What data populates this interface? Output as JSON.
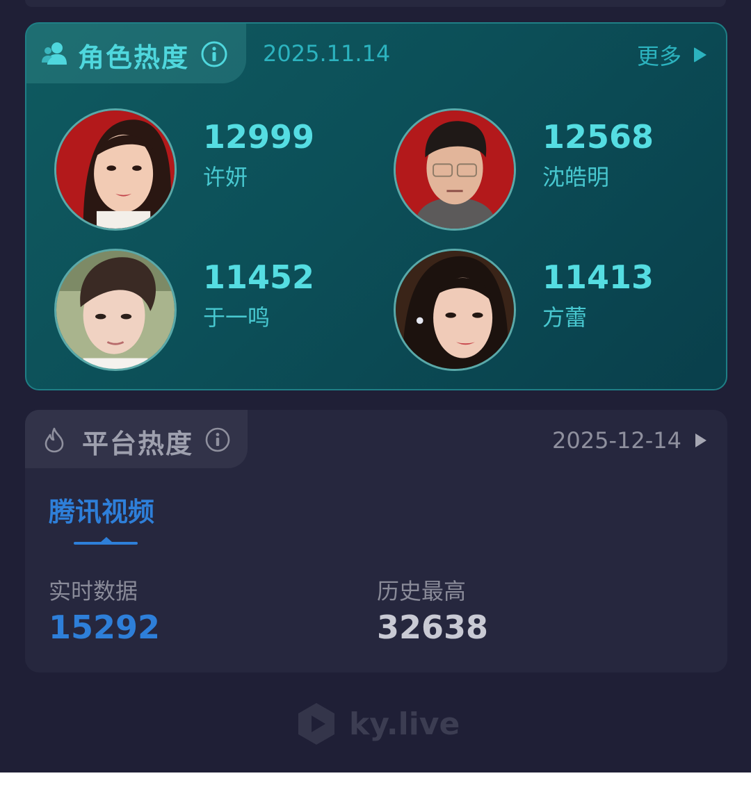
{
  "role_heat": {
    "title": "角色热度",
    "date": "2025.11.14",
    "more_label": "更多",
    "characters": [
      {
        "score": "12999",
        "name": "许妍"
      },
      {
        "score": "12568",
        "name": "沈皓明"
      },
      {
        "score": "11452",
        "name": "于一鸣"
      },
      {
        "score": "11413",
        "name": "方蕾"
      }
    ]
  },
  "platform_heat": {
    "title": "平台热度",
    "date": "2025-12-14",
    "tab_label": "腾讯视频",
    "realtime_label": "实时数据",
    "realtime_value": "15292",
    "history_label": "历史最高",
    "history_value": "32638"
  },
  "watermark": "ky.live",
  "colors": {
    "background": "#1f1f36",
    "role_card_accent": "#55dde2",
    "platform_accent": "#2e7fd9",
    "muted_text": "#8a8b99"
  }
}
